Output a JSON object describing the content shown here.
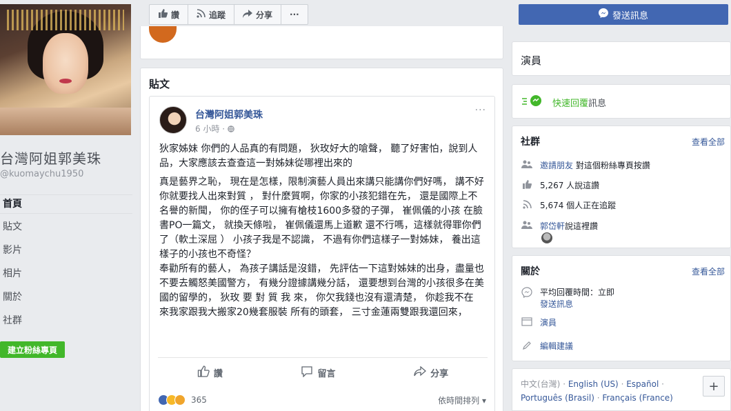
{
  "page": {
    "name": "台灣阿姐郭美珠",
    "handle": "@kuomaychu1950",
    "create_page": "建立粉絲專頁"
  },
  "nav": {
    "items": [
      {
        "label": "首頁"
      },
      {
        "label": "貼文"
      },
      {
        "label": "影片"
      },
      {
        "label": "相片"
      },
      {
        "label": "關於"
      },
      {
        "label": "社群"
      }
    ]
  },
  "top_actions": {
    "like": "讚",
    "follow": "追蹤",
    "share": "分享",
    "more": "···"
  },
  "posts": {
    "section_title": "貼文",
    "post": {
      "author": "台灣阿姐郭美珠",
      "time": "6 小時",
      "more": "···",
      "paragraph1": "狄家姊妹 你們的人品真的有問題， 狄玫好大的嗆聲， 聽了好害怕，說到人品，大家應該去查查這一對姊妹從哪裡出來的",
      "paragraph2": "真是藝界之恥， 現在是怎樣，限制演藝人員出來講只能講你們好嗎， 講不好你就要找人出來對質 ， 對什麼質啊，你家的小孩犯錯在先， 還是國際上不名譽的新聞， 你的侄子可以擁有槍枝1600多發的子彈， 崔佩儀的小孩 在臉書PO一篇文， 就換天條啦， 崔佩儀還馬上道歉 還不行嗎，這樣就得罪你們了（軟土深屈 ） 小孩子我是不認識， 不過有你們這樣子一對姊妹， 養出這樣子的小孩也不奇怪？",
      "paragraph3": "奉勸所有的藝人， 為孩子講話是沒錯， 先評估一下這對姊妹的出身，盡量也不要去觸怒美國警方， 有幾分證據講幾分話， 還要想到台灣的小孩很多在美國的留學的， 狄玫 要 對 質 我 來， 你欠我錢也沒有還清楚， 你趁我不在 來我家跟我大搬家20幾套服裝 所有的頭套， 三寸金蓮兩雙跟我還回來，",
      "action_like": "讚",
      "action_comment": "留言",
      "action_share": "分享",
      "reaction_count": "365",
      "sort_label": "依時間排列 ▾"
    }
  },
  "right": {
    "send_message": "發送訊息",
    "category": "演員",
    "quick_reply": "快速回覆",
    "quick_reply_suffix": "訊息",
    "community": {
      "title": "社群",
      "see_all": "查看全部",
      "invite_link": "邀請朋友",
      "invite_text": "對這個粉絲專頁按讚",
      "likes": "5,267 人說這讚",
      "follows": "5,674 個人正在追蹤",
      "friend_link": "郭岱軒",
      "friend_text": "說這裡讚"
    },
    "about": {
      "title": "關於",
      "see_all": "查看全部",
      "response": "平均回覆時間：立即",
      "send_message": "發送訊息",
      "category": "演員",
      "suggest_edit": "編輯建議"
    },
    "languages": {
      "current": "中文(台灣)",
      "others": [
        "English (US)",
        "Español",
        "Português (Brasil)",
        "Français (France)"
      ],
      "plus": "+"
    }
  },
  "colors": {
    "fb_blue": "#4267b2",
    "link": "#365899",
    "green": "#42b72a",
    "bg": "#e9ebee"
  }
}
